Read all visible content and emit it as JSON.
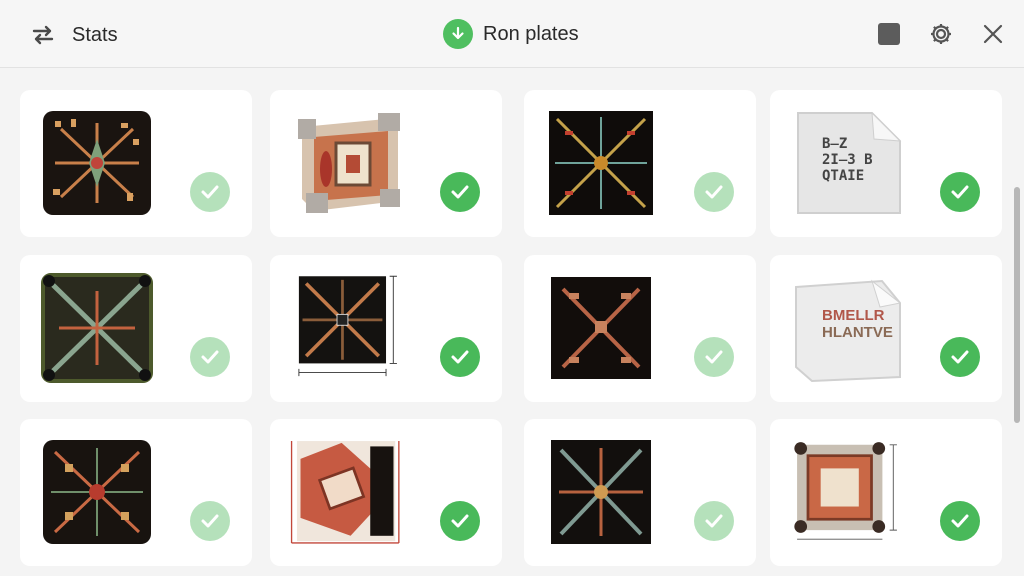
{
  "titlebar": {
    "left_icon": "sync-icon",
    "left_title": "Stats",
    "center_icon": "download-icon",
    "center_title": "Ron plates",
    "right_icons": [
      "stop-icon",
      "gear-icon",
      "close-icon"
    ]
  },
  "colors": {
    "accent_green": "#49b95a",
    "faded_green": "#a9dcb0",
    "background": "#f4f4f4"
  },
  "grid": {
    "items": [
      {
        "kind": "tile-star",
        "status": "faded"
      },
      {
        "kind": "frame-block",
        "status": "done"
      },
      {
        "kind": "tile-cross",
        "status": "faded"
      },
      {
        "kind": "paper-bag",
        "status": "done",
        "text_lines": [
          "B̶Z",
          "2I̶3 B",
          "QTAIE"
        ]
      },
      {
        "kind": "tile-green-x",
        "status": "faded"
      },
      {
        "kind": "tile-dimensioned",
        "status": "done"
      },
      {
        "kind": "tile-arrows",
        "status": "faded"
      },
      {
        "kind": "paper-bag",
        "status": "done",
        "text_lines": [
          "BMELLR",
          "HLANTVE"
        ]
      },
      {
        "kind": "tile-woven",
        "status": "faded"
      },
      {
        "kind": "panel-red",
        "status": "done"
      },
      {
        "kind": "tile-x-dark",
        "status": "faded"
      },
      {
        "kind": "plate-bolted",
        "status": "done"
      }
    ]
  }
}
